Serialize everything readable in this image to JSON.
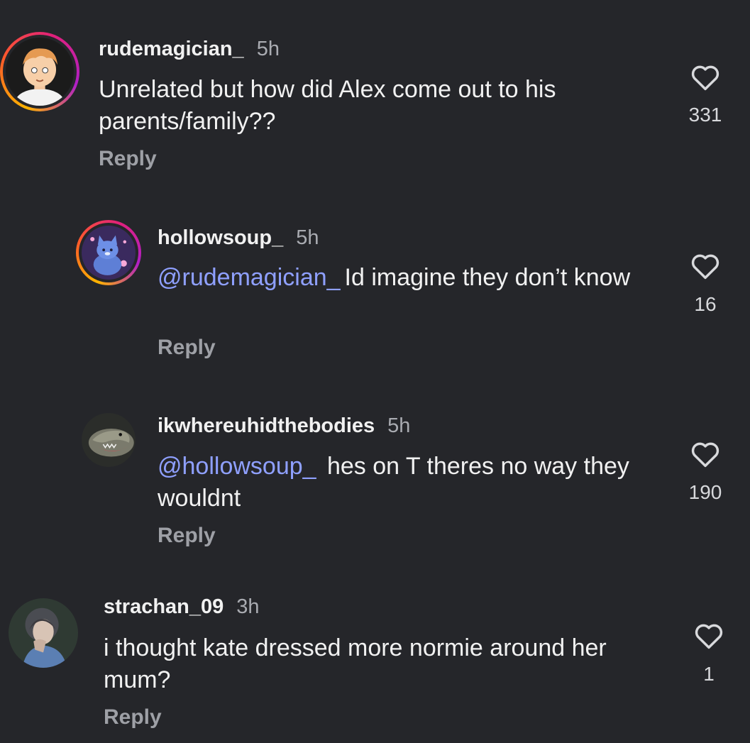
{
  "comments": [
    {
      "username": "rudemagician_",
      "time": "5h",
      "mention": "",
      "text": "Unrelated but how did Alex come out to his parents/family??",
      "reply_label": "Reply",
      "likes": "331",
      "avatar": "cartoon-boy-avatar"
    },
    {
      "username": "hollowsoup_",
      "time": "5h",
      "mention": "@rudemagician_",
      "text": "Id imagine they don’t know",
      "reply_label": "Reply",
      "likes": "16",
      "avatar": "blue-cat-avatar"
    },
    {
      "username": "ikwhereuhidthebodies",
      "time": "5h",
      "mention": "@hollowsoup_",
      "text": " hes on T theres no way they wouldnt",
      "reply_label": "Reply",
      "likes": "190",
      "avatar": "dinosaur-avatar"
    },
    {
      "username": "strachan_09",
      "time": "3h",
      "mention": "",
      "text": "i thought kate dressed more normie around her mum?",
      "reply_label": "Reply",
      "likes": "1",
      "avatar": "photo-avatar"
    }
  ],
  "colors": {
    "background": "#25262a",
    "mention": "#8fa0ff",
    "muted": "#a9abb1"
  }
}
